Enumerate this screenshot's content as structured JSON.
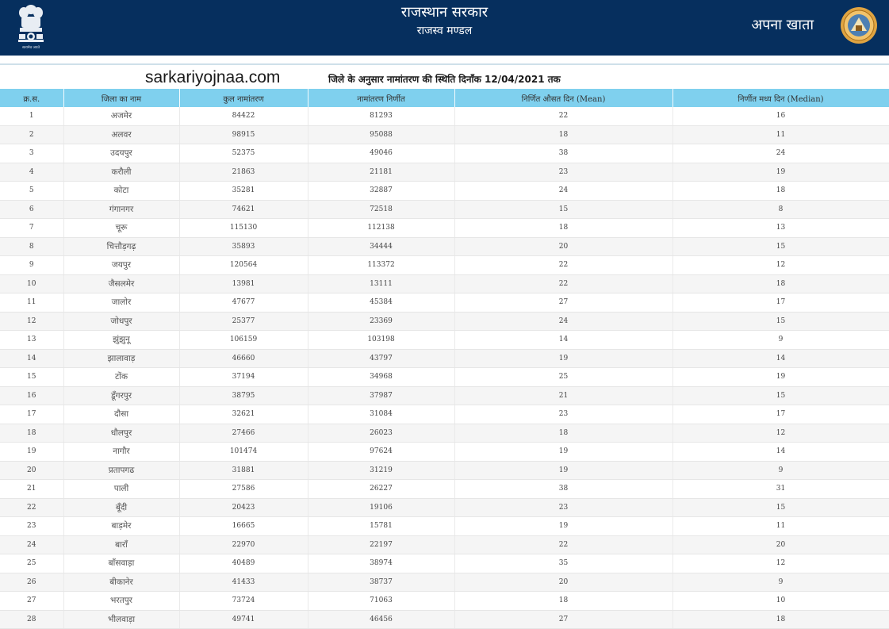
{
  "header": {
    "emblem_icon": "ashoka-emblem-icon",
    "emblem_motto": "सत्यमेव जयते",
    "title": "राजस्थान सरकार",
    "subtitle": "राजस्व मण्डल",
    "brand": "अपना खाता",
    "seal_icon": "revenue-board-seal-icon",
    "bg_color": "#062f5e"
  },
  "subheader": {
    "site": "sarkariyojnaa.com",
    "caption": "जिले के अनुसार नामांतरण की स्थिति दिनाँक 12/04/2021 तक"
  },
  "table": {
    "header_color": "#7fd0ee",
    "columns": [
      "क्र.स.",
      "जिला का नाम",
      "कुल नामांतरण",
      "नामांतरण निर्णीत",
      "निर्णित औसत दिन (Mean)",
      "निर्णीत मध्य दिन (Median)"
    ],
    "rows": [
      [
        "1",
        "अजमेर",
        "84422",
        "81293",
        "22",
        "16"
      ],
      [
        "2",
        "अलवर",
        "98915",
        "95088",
        "18",
        "11"
      ],
      [
        "3",
        "उदयपुर",
        "52375",
        "49046",
        "38",
        "24"
      ],
      [
        "4",
        "करौली",
        "21863",
        "21181",
        "23",
        "19"
      ],
      [
        "5",
        "कोटा",
        "35281",
        "32887",
        "24",
        "18"
      ],
      [
        "6",
        "गंगानगर",
        "74621",
        "72518",
        "15",
        "8"
      ],
      [
        "7",
        "चूरू",
        "115130",
        "112138",
        "18",
        "13"
      ],
      [
        "8",
        "चित्तौड़गढ़",
        "35893",
        "34444",
        "20",
        "15"
      ],
      [
        "9",
        "जयपुर",
        "120564",
        "113372",
        "22",
        "12"
      ],
      [
        "10",
        "जैसलमेर",
        "13981",
        "13111",
        "22",
        "18"
      ],
      [
        "11",
        "जालोर",
        "47677",
        "45384",
        "27",
        "17"
      ],
      [
        "12",
        "जोधपुर",
        "25377",
        "23369",
        "24",
        "15"
      ],
      [
        "13",
        "झुंझुनू",
        "106159",
        "103198",
        "14",
        "9"
      ],
      [
        "14",
        "झालावाड़",
        "46660",
        "43797",
        "19",
        "14"
      ],
      [
        "15",
        "टोंक",
        "37194",
        "34968",
        "25",
        "19"
      ],
      [
        "16",
        "डूँगरपुर",
        "38795",
        "37987",
        "21",
        "15"
      ],
      [
        "17",
        "दौसा",
        "32621",
        "31084",
        "23",
        "17"
      ],
      [
        "18",
        "धौलपुर",
        "27466",
        "26023",
        "18",
        "12"
      ],
      [
        "19",
        "नागौर",
        "101474",
        "97624",
        "19",
        "14"
      ],
      [
        "20",
        "प्रतापगढ",
        "31881",
        "31219",
        "19",
        "9"
      ],
      [
        "21",
        "पाली",
        "27586",
        "26227",
        "38",
        "31"
      ],
      [
        "22",
        "बूँदी",
        "20423",
        "19106",
        "23",
        "15"
      ],
      [
        "23",
        "बाड़मेर",
        "16665",
        "15781",
        "19",
        "11"
      ],
      [
        "24",
        "बाराँ",
        "22970",
        "22197",
        "22",
        "20"
      ],
      [
        "25",
        "बाँसवाड़ा",
        "40489",
        "38974",
        "35",
        "12"
      ],
      [
        "26",
        "बीकानेर",
        "41433",
        "38737",
        "20",
        "9"
      ],
      [
        "27",
        "भरतपुर",
        "73724",
        "71063",
        "18",
        "10"
      ],
      [
        "28",
        "भीलवाड़ा",
        "49741",
        "46456",
        "27",
        "18"
      ]
    ]
  }
}
